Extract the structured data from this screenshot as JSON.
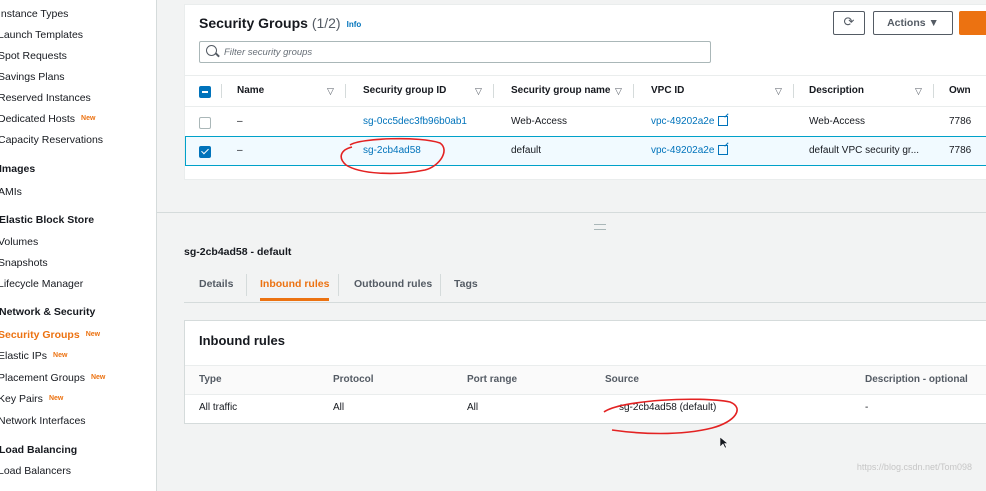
{
  "sidebar": {
    "items": [
      {
        "label": "Instance Types",
        "type": "item"
      },
      {
        "label": "Launch Templates",
        "type": "item"
      },
      {
        "label": "Spot Requests",
        "type": "item"
      },
      {
        "label": "Savings Plans",
        "type": "item"
      },
      {
        "label": "Reserved Instances",
        "type": "item"
      },
      {
        "label": "Dedicated Hosts",
        "type": "item",
        "badge": "New"
      },
      {
        "label": "Capacity Reservations",
        "type": "item"
      },
      {
        "label": "Images",
        "type": "heading"
      },
      {
        "label": "AMIs",
        "type": "item"
      },
      {
        "label": "Elastic Block Store",
        "type": "heading"
      },
      {
        "label": "Volumes",
        "type": "item"
      },
      {
        "label": "Snapshots",
        "type": "item"
      },
      {
        "label": "Lifecycle Manager",
        "type": "item"
      },
      {
        "label": "Network & Security",
        "type": "heading"
      },
      {
        "label": "Security Groups",
        "type": "active",
        "badge": "New"
      },
      {
        "label": "Elastic IPs",
        "type": "item",
        "badge": "New"
      },
      {
        "label": "Placement Groups",
        "type": "item",
        "badge": "New"
      },
      {
        "label": "Key Pairs",
        "type": "item",
        "badge": "New"
      },
      {
        "label": "Network Interfaces",
        "type": "item"
      },
      {
        "label": "Load Balancing",
        "type": "heading"
      },
      {
        "label": "Load Balancers",
        "type": "item"
      }
    ]
  },
  "header": {
    "title": "Security Groups",
    "count": "(1/2)",
    "info": "Info",
    "refresh_icon": "refresh-icon",
    "actions_label": "Actions ▼"
  },
  "search": {
    "placeholder": "Filter security groups"
  },
  "table": {
    "columns": [
      "Name",
      "Security group ID",
      "Security group name",
      "VPC ID",
      "Description",
      "Own"
    ],
    "rows": [
      {
        "name": "–",
        "id": "sg-0cc5dec3fb96b0ab1",
        "group_name": "Web-Access",
        "vpc": "vpc-49202a2e",
        "description": "Web-Access",
        "owner": "7786",
        "selected": false
      },
      {
        "name": "–",
        "id": "sg-2cb4ad58",
        "group_name": "default",
        "vpc": "vpc-49202a2e",
        "description": "default VPC security gr...",
        "owner": "7786",
        "selected": true
      }
    ]
  },
  "details": {
    "title": "sg-2cb4ad58 - default",
    "tabs": [
      "Details",
      "Inbound rules",
      "Outbound rules",
      "Tags"
    ],
    "active_tab": "Inbound rules"
  },
  "inbound": {
    "title": "Inbound rules",
    "columns": [
      "Type",
      "Protocol",
      "Port range",
      "Source",
      "Description - optional"
    ],
    "rows": [
      {
        "type": "All traffic",
        "protocol": "All",
        "port_range": "All",
        "source": "sg-2cb4ad58 (default)",
        "description": "-"
      }
    ]
  },
  "watermark": "https://blog.csdn.net/Tom098",
  "colors": {
    "accent": "#ec7211",
    "link": "#0073bb",
    "annotation": "#e32222"
  }
}
